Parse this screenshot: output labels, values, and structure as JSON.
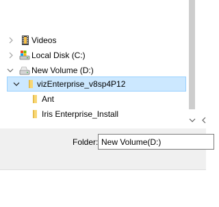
{
  "tree": {
    "items": [
      {
        "label": "Videos",
        "icon": "videos-folder-icon",
        "expand": "collapsed-chevron"
      },
      {
        "label": "Local Disk (C:)",
        "icon": "system-drive-icon",
        "expand": "collapsed-chevron"
      },
      {
        "label": "New Volume (D:)",
        "icon": "drive-icon",
        "expand": "expanded-chevron"
      },
      {
        "label": "vizEnterprise_v8sp4P12",
        "icon": "folder-icon",
        "expand": "expanded-chevron",
        "selected": true
      },
      {
        "label": "Ant",
        "icon": "folder-icon"
      },
      {
        "label": "Iris Enterprise_Install",
        "icon": "folder-icon"
      }
    ]
  },
  "folder_field": {
    "label": "Folder:",
    "value": "New Volume(D:)"
  },
  "colors": {
    "selection_bg": "#cce8ff",
    "selection_border": "#99d1ff",
    "folder_yellow": "#f8d775",
    "pane_bg": "#f0f0f0"
  }
}
